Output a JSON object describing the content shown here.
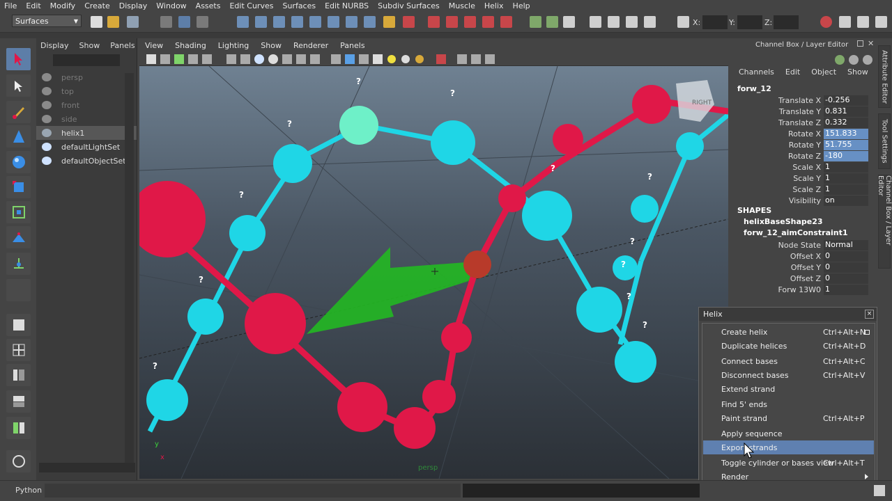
{
  "menubar": [
    "File",
    "Edit",
    "Modify",
    "Create",
    "Display",
    "Window",
    "Assets",
    "Edit Curves",
    "Surfaces",
    "Edit NURBS",
    "Subdiv Surfaces",
    "Muscle",
    "Helix",
    "Help"
  ],
  "status": {
    "mode": "Surfaces",
    "x_label": "X:",
    "y_label": "Y:",
    "z_label": "Z:"
  },
  "outliner": {
    "menu": [
      "Display",
      "Show",
      "Panels"
    ],
    "items": [
      {
        "label": "persp",
        "state": "dim",
        "icon": "camera-icon"
      },
      {
        "label": "top",
        "state": "dim",
        "icon": "camera-icon"
      },
      {
        "label": "front",
        "state": "dim",
        "icon": "camera-icon"
      },
      {
        "label": "side",
        "state": "dim",
        "icon": "camera-icon"
      },
      {
        "label": "helix1",
        "state": "selected",
        "icon": "transform-icon"
      },
      {
        "label": "defaultLightSet",
        "state": "normal",
        "icon": "set-icon"
      },
      {
        "label": "defaultObjectSet",
        "state": "normal",
        "icon": "set-icon"
      }
    ]
  },
  "viewport": {
    "menu": [
      "View",
      "Shading",
      "Lighting",
      "Show",
      "Renderer",
      "Panels"
    ],
    "camera_label": "persp",
    "viewcube_label": "RIGHT",
    "axis_x": "x",
    "axis_y": "y",
    "question_mark": "?"
  },
  "channelbox": {
    "title": "Channel Box / Layer Editor",
    "menu": [
      "Channels",
      "Edit",
      "Object",
      "Show"
    ],
    "object": "forw_12",
    "attributes": [
      {
        "name": "Translate X",
        "value": "-0.256",
        "highlight": false
      },
      {
        "name": "Translate Y",
        "value": "0.831",
        "highlight": false
      },
      {
        "name": "Translate Z",
        "value": "0.332",
        "highlight": false
      },
      {
        "name": "Rotate X",
        "value": "151.833",
        "highlight": true
      },
      {
        "name": "Rotate Y",
        "value": "51.755",
        "highlight": true
      },
      {
        "name": "Rotate Z",
        "value": "-180",
        "highlight": true
      },
      {
        "name": "Scale X",
        "value": "1",
        "highlight": false
      },
      {
        "name": "Scale Y",
        "value": "1",
        "highlight": false
      },
      {
        "name": "Scale Z",
        "value": "1",
        "highlight": false
      },
      {
        "name": "Visibility",
        "value": "on",
        "highlight": false
      }
    ],
    "shapes_header": "SHAPES",
    "shapes": [
      "helixBaseShape23",
      "forw_12_aimConstraint1"
    ],
    "constraint_attributes": [
      {
        "name": "Node State",
        "value": "Normal"
      },
      {
        "name": "Offset X",
        "value": "0"
      },
      {
        "name": "Offset Y",
        "value": "0"
      },
      {
        "name": "Offset Z",
        "value": "0"
      },
      {
        "name": "Forw 13W0",
        "value": "1"
      }
    ]
  },
  "sidetabs": [
    "Attribute Editor",
    "Tool Settings",
    "Channel Box / Layer Editor"
  ],
  "helix_menu": {
    "title": "Helix",
    "close": "×",
    "items": [
      {
        "label": "Create helix",
        "shortcut": "Ctrl+Alt+N",
        "option": true,
        "submenu": false,
        "selected": false
      },
      {
        "label": "Duplicate helices",
        "shortcut": "Ctrl+Alt+D",
        "option": false,
        "submenu": false,
        "selected": false
      },
      {
        "label": "Connect bases",
        "shortcut": "Ctrl+Alt+C",
        "option": false,
        "submenu": false,
        "selected": false
      },
      {
        "label": "Disconnect bases",
        "shortcut": "Ctrl+Alt+V",
        "option": false,
        "submenu": false,
        "selected": false
      },
      {
        "label": "Extend strand",
        "shortcut": "",
        "option": false,
        "submenu": false,
        "selected": false
      },
      {
        "label": "Find 5' ends",
        "shortcut": "",
        "option": false,
        "submenu": false,
        "selected": false
      },
      {
        "label": "Paint strand",
        "shortcut": "Ctrl+Alt+P",
        "option": false,
        "submenu": false,
        "selected": false
      },
      {
        "label": "Apply sequence",
        "shortcut": "",
        "option": false,
        "submenu": false,
        "selected": false
      },
      {
        "label": "Export strands",
        "shortcut": "",
        "option": false,
        "submenu": false,
        "selected": true
      },
      {
        "label": "Toggle cylinder or bases view",
        "shortcut": "Ctrl+Alt+T",
        "option": false,
        "submenu": false,
        "selected": false
      },
      {
        "label": "Render",
        "shortcut": "",
        "option": false,
        "submenu": true,
        "selected": false
      }
    ]
  },
  "cmdline": {
    "lang": "Python"
  },
  "colors": {
    "cyan": "#1fd6e6",
    "red": "#e01848",
    "green": "#22b822",
    "selection": "#5f80b0"
  }
}
